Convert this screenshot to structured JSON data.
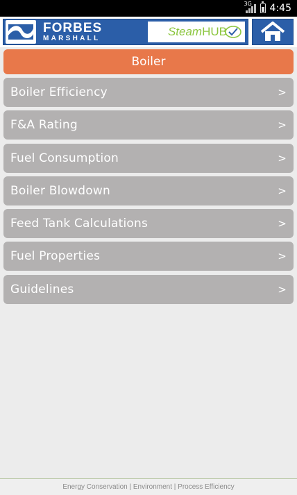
{
  "status_bar": {
    "network": "3G",
    "time": "4:45"
  },
  "header": {
    "brand_line1": "FORBES",
    "brand_line2": "MARSHALL",
    "app_name_steam": "Steam",
    "app_name_hub": "HUB",
    "brand_color": "#2b5ea8",
    "accent_green": "#8cc63f",
    "home_icon": "home-icon"
  },
  "section": {
    "title": "Boiler",
    "color": "#e8784a"
  },
  "menu": {
    "items": [
      {
        "label": "Boiler Efficiency"
      },
      {
        "label": "F&A Rating"
      },
      {
        "label": "Fuel Consumption"
      },
      {
        "label": "Boiler Blowdown"
      },
      {
        "label": "Feed Tank Calculations"
      },
      {
        "label": "Fuel Properties"
      },
      {
        "label": "Guidelines"
      }
    ],
    "chevron": ">",
    "item_color": "#b3b1b1"
  },
  "footer": {
    "text": "Energy Conservation | Environment | Process Efficiency"
  }
}
